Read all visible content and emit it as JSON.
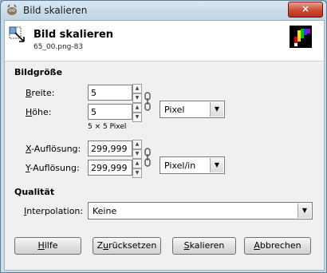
{
  "window": {
    "title": "Bild skalieren",
    "close_label": "×"
  },
  "header": {
    "title": "Bild skalieren",
    "subtitle": "65_00.png-83"
  },
  "image_size": {
    "section_title": "Bildgröße",
    "width_label_mnemonic": "B",
    "width_label_rest": "reite:",
    "width_value": "5",
    "height_label_mnemonic": "H",
    "height_label_rest": "öhe:",
    "height_value": "5",
    "unit": "Pixel",
    "dimensions_note": "5 × 5 Pixel",
    "xres_label_mnemonic": "X",
    "xres_label_rest": "-Auflösung:",
    "xres_value": "299,999",
    "yres_label_mnemonic": "Y",
    "yres_label_rest": "-Auflösung:",
    "yres_value": "299,999",
    "res_unit": "Pixel/in"
  },
  "quality": {
    "section_title": "Qualität",
    "interp_label_mnemonic": "I",
    "interp_label_rest": "nterpolation:",
    "interp_value": "Keine"
  },
  "buttons": {
    "help_mnemonic": "H",
    "help_rest": "ilfe",
    "reset_pre": "Z",
    "reset_mnemonic": "u",
    "reset_rest": "rücksetzen",
    "scale_mnemonic": "S",
    "scale_rest": "kalieren",
    "cancel_mnemonic": "A",
    "cancel_rest": "bbrechen"
  },
  "colors": {
    "title_bar": "#c8dbe8",
    "close_button": "#cc4a33",
    "dialog_bg": "#f0f0f0"
  },
  "icons": {
    "title": "gimp-icon",
    "header": "scale-image-icon",
    "chain": "chain-link-icon"
  }
}
